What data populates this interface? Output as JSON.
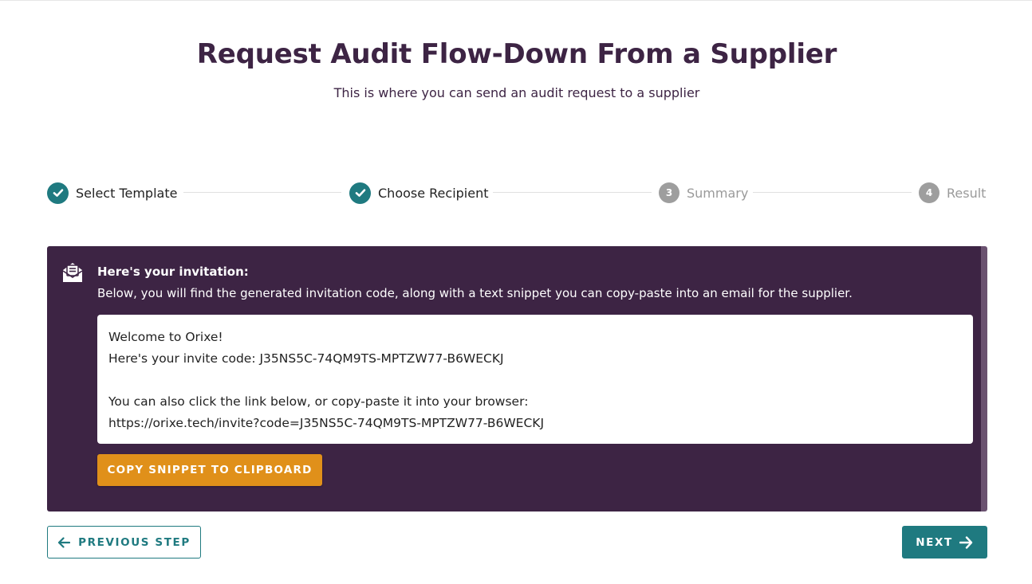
{
  "header": {
    "title": "Request Audit Flow-Down From a Supplier",
    "subtitle": "This is where you can send an audit request to a supplier"
  },
  "stepper": {
    "steps": [
      {
        "label": "Select Template",
        "status": "completed"
      },
      {
        "label": "Choose Recipient",
        "status": "completed"
      },
      {
        "label": "Summary",
        "number": "3",
        "status": "pending"
      },
      {
        "label": "Result",
        "number": "4",
        "status": "pending"
      }
    ]
  },
  "invitation": {
    "icon": "envelope-open-icon",
    "heading": "Here's your invitation:",
    "description": "Below, you will find the generated invitation code, along with a text snippet you can copy-paste into an email for the supplier.",
    "snippet_lines": [
      "Welcome to Orixe!",
      "Here's your invite code: J35NS5C-74QM9TS-MPTZW77-B6WECKJ",
      "",
      "You can also click the link below, or copy-paste it into your browser:",
      "https://orixe.tech/invite?code=J35NS5C-74QM9TS-MPTZW77-B6WECKJ"
    ],
    "copy_button_label": "COPY SNIPPET TO CLIPBOARD"
  },
  "footer": {
    "previous_label": "PREVIOUS STEP",
    "next_label": "NEXT"
  },
  "colors": {
    "brand_purple": "#3d2444",
    "teal": "#1f7a80",
    "orange": "#e0901a",
    "pending_gray": "#9e9e9e"
  }
}
